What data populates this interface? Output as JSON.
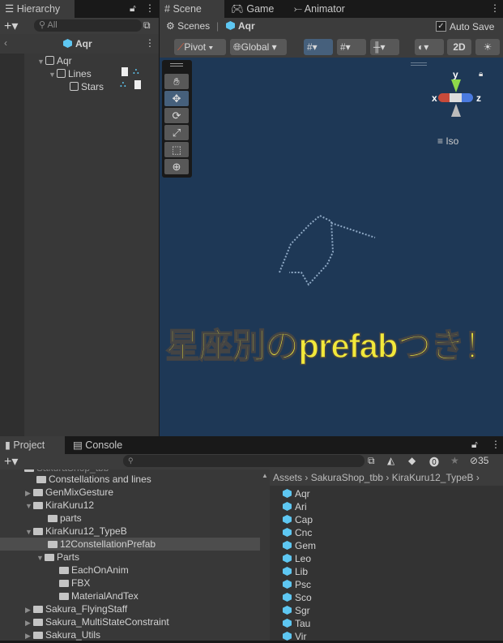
{
  "hierarchy": {
    "tab": "Hierarchy",
    "search_placeholder": "All",
    "prefab_title": "Aqr",
    "items": [
      {
        "label": "Aqr"
      },
      {
        "label": "Lines"
      },
      {
        "label": "Stars"
      }
    ]
  },
  "scene_tabs": [
    {
      "label": "Scene"
    },
    {
      "label": "Game"
    },
    {
      "label": "Animator"
    }
  ],
  "scene": {
    "breadcrumb_root": "Scenes",
    "breadcrumb_prefab": "Aqr",
    "auto_save_label": "Auto Save",
    "auto_save": true,
    "pivot": "Pivot",
    "global": "Global",
    "mode_2d": "2D",
    "gizmo": {
      "x": "x",
      "y": "y",
      "z": "z",
      "projection": "Iso"
    },
    "overlay_caption": "星座別のprefabつき！",
    "colors": {
      "background": "#1e3856",
      "caption": "#f2e83a"
    }
  },
  "bottom_tabs": [
    {
      "label": "Project"
    },
    {
      "label": "Console"
    }
  ],
  "project": {
    "hidden_count": "35",
    "folders": [
      {
        "label": "Constellations and lines"
      },
      {
        "label": "GenMixGesture"
      },
      {
        "label": "KiraKuru12"
      },
      {
        "label": "parts"
      },
      {
        "label": "KiraKuru12_TypeB"
      },
      {
        "label": "12ConstellationPrefab"
      },
      {
        "label": "Parts"
      },
      {
        "label": "EachOnAnim"
      },
      {
        "label": "FBX"
      },
      {
        "label": "MaterialAndTex"
      },
      {
        "label": "Sakura_FlyingStaff"
      },
      {
        "label": "Sakura_MultiStateConstraint"
      },
      {
        "label": "Sakura_Utils"
      }
    ],
    "breadcrumb": [
      "Assets",
      "SakuraShop_tbb",
      "KiraKuru12_TypeB"
    ],
    "assets": [
      "Aqr",
      "Ari",
      "Cap",
      "Cnc",
      "Gem",
      "Leo",
      "Lib",
      "Psc",
      "Sco",
      "Sgr",
      "Tau",
      "Vir"
    ]
  }
}
